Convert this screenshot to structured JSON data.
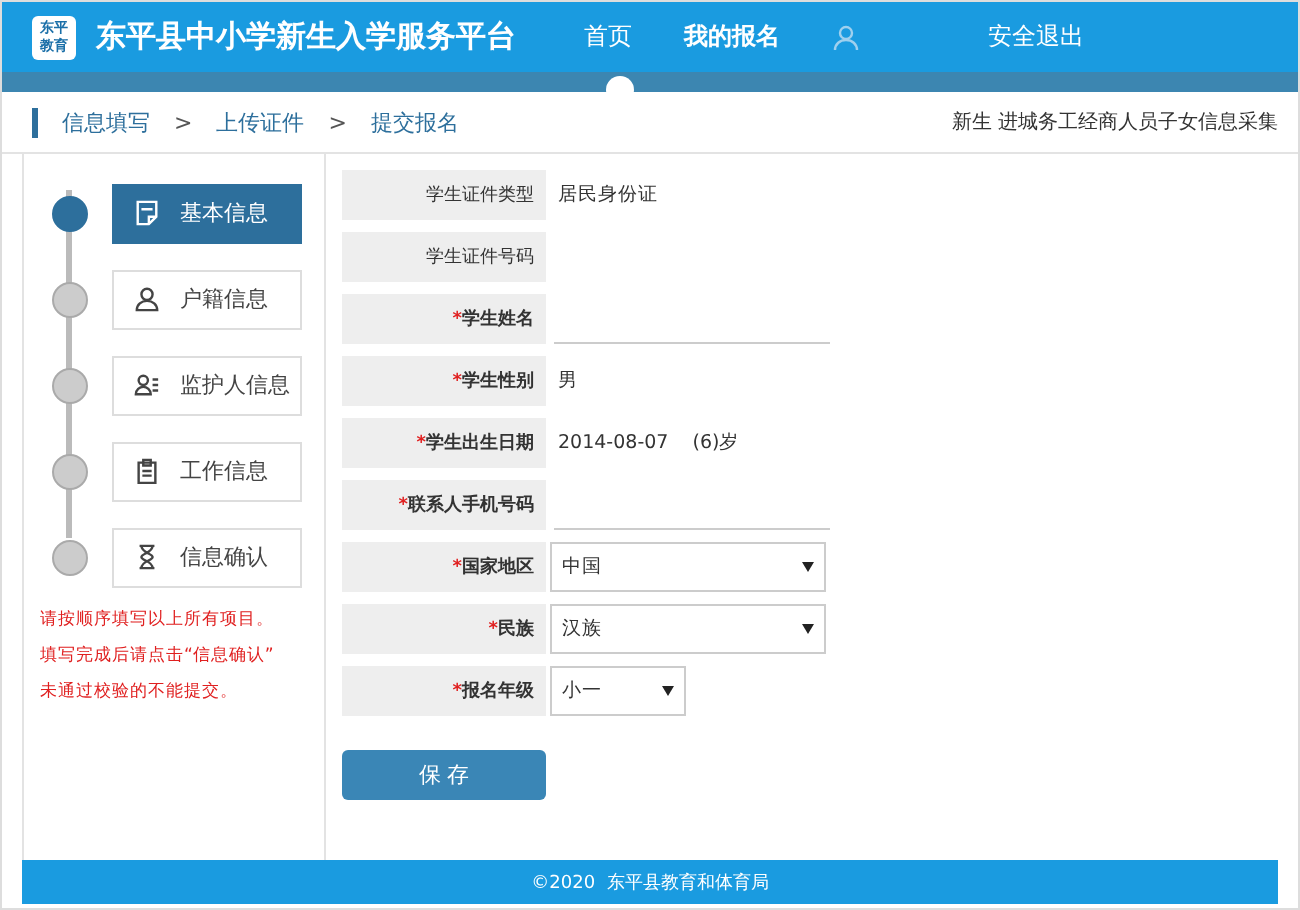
{
  "header": {
    "logo": [
      "东平",
      "教育"
    ],
    "title": "东平县中小学新生入学服务平台",
    "nav": [
      {
        "label": "首页",
        "selected": false
      },
      {
        "label": "我的报名",
        "selected": true
      }
    ],
    "logout": "安全退出"
  },
  "breadcrumb": [
    "信息填写",
    ">",
    "上传证件",
    ">",
    "提交报名"
  ],
  "category": "新生 进城务工经商人员子女信息采集",
  "steps": [
    {
      "label": "基本信息",
      "selected": true
    },
    {
      "label": "户籍信息",
      "selected": false
    },
    {
      "label": "监护人信息",
      "selected": false
    },
    {
      "label": "工作信息",
      "selected": false
    },
    {
      "label": "信息确认",
      "selected": false
    }
  ],
  "required_mark": "*",
  "notes": [
    "请按顺序填写以上所有项目。",
    "填写完成后请点击“信息确认”",
    "未通过校验的不能提交。"
  ],
  "fields": [
    {
      "label": "学生证件类型",
      "required": false,
      "kind": "text",
      "value": "居民身份证"
    },
    {
      "label": "学生证件号码",
      "required": false,
      "kind": "text"
    },
    {
      "label": "学生姓名",
      "required": true,
      "kind": "input"
    },
    {
      "label": "学生性别",
      "required": true,
      "kind": "text",
      "value": "男"
    },
    {
      "label": "学生出生日期",
      "required": true,
      "kind": "text",
      "value": "2014-08-07    (6)岁"
    },
    {
      "label": "联系人手机号码",
      "required": true,
      "kind": "input"
    },
    {
      "label": "国家地区",
      "required": true,
      "kind": "select",
      "value": "中国"
    },
    {
      "label": "民族",
      "required": true,
      "kind": "select",
      "value": "汉族"
    },
    {
      "label": "报名年级",
      "required": true,
      "kind": "select-small",
      "value": "小一"
    }
  ],
  "save": "保 存",
  "footer": "©2020  东平县教育和体育局"
}
